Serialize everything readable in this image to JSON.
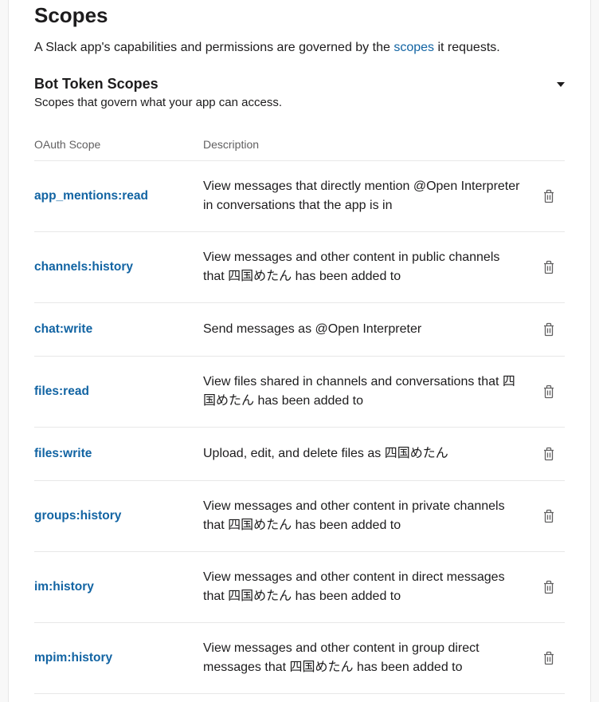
{
  "section": {
    "title": "Scopes",
    "desc_before": "A Slack app's capabilities and permissions are governed by the ",
    "desc_link": "scopes",
    "desc_after": " it requests."
  },
  "subsection": {
    "title": "Bot Token Scopes",
    "desc": "Scopes that govern what your app can access."
  },
  "table_header": {
    "scope": "OAuth Scope",
    "desc": "Description"
  },
  "scopes": [
    {
      "name": "app_mentions:read",
      "desc": "View messages that directly mention @Open Interpreter in conversations that the app is in"
    },
    {
      "name": "channels:history",
      "desc": "View messages and other content in public channels that 四国めたん has been added to"
    },
    {
      "name": "chat:write",
      "desc": "Send messages as @Open Interpreter"
    },
    {
      "name": "files:read",
      "desc": "View files shared in channels and conversations that 四国めたん has been added to"
    },
    {
      "name": "files:write",
      "desc": "Upload, edit, and delete files as 四国めたん"
    },
    {
      "name": "groups:history",
      "desc": "View messages and other content in private channels that 四国めたん has been added to"
    },
    {
      "name": "im:history",
      "desc": "View messages and other content in direct messages that 四国めたん has been added to"
    },
    {
      "name": "mpim:history",
      "desc": "View messages and other content in group direct messages that 四国めたん has been added to"
    }
  ]
}
